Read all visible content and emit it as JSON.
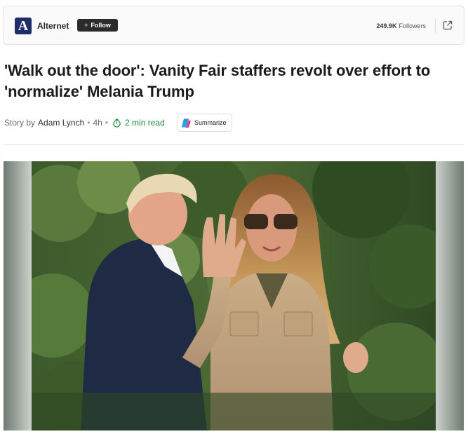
{
  "publisher": {
    "logo_letter": "A",
    "name": "Alternet",
    "follow_label": "Follow",
    "follow_plus": "+",
    "followers_count": "249.9K",
    "followers_label": "Followers",
    "open_icon": "external-link-icon"
  },
  "article": {
    "headline": "'Walk out the door': Vanity Fair staffers revolt over effort to 'normalize' Melania Trump",
    "story_by": "Story by",
    "author": "Adam Lynch",
    "age": "4h",
    "read_time": "2 min read",
    "summarize_label": "Summarize",
    "summarize_icon": "copilot-icon",
    "timer_icon": "stopwatch-icon"
  },
  "colors": {
    "logo_bg": "#1f2d6b",
    "follow_bg": "#2b2b2b",
    "read_time": "#1f8a3b"
  }
}
